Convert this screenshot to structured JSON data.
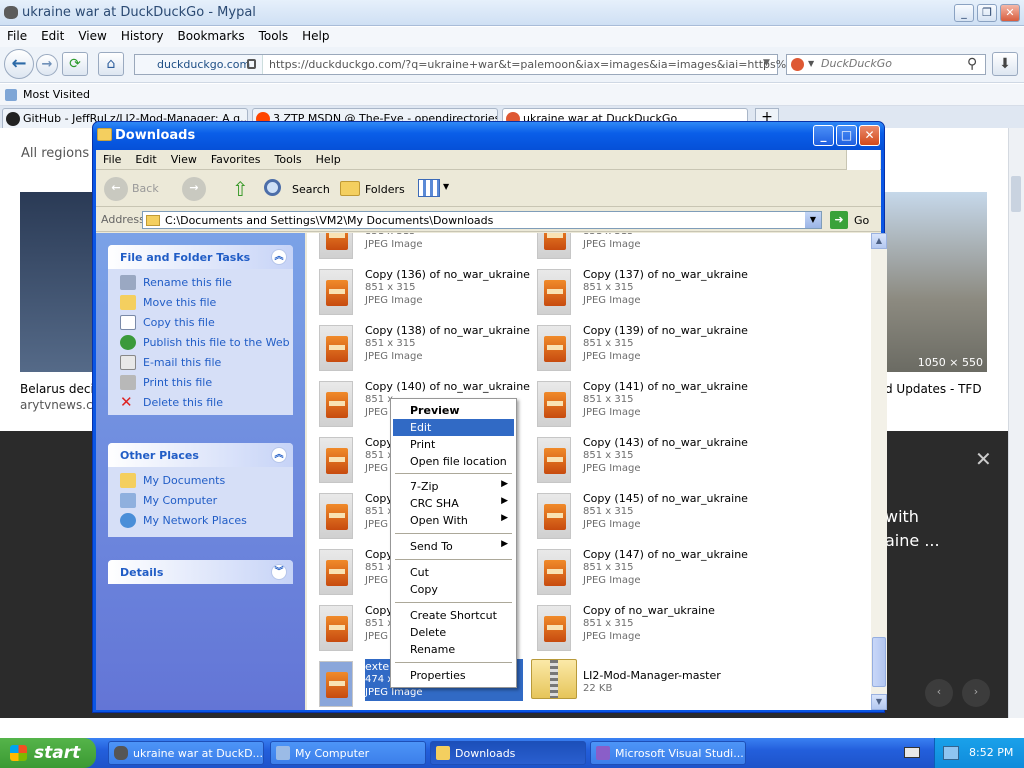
{
  "browser": {
    "title": "ukraine war at DuckDuckGo - Mypal",
    "menu": [
      "File",
      "Edit",
      "View",
      "History",
      "Bookmarks",
      "Tools",
      "Help"
    ],
    "site_label": "duckduckgo.com",
    "url": "https://duckduckgo.com/?q=ukraine+war&t=palemoon&iax=images&ia=images&iai=https%3A%",
    "search_placeholder": "DuckDuckGo",
    "bookmark": "Most Visited",
    "tabs": [
      "GitHub - JeffRuLz/LI2-Mod-Manager: A g...",
      "3 ZTP MSDN @ The-Eye - opendirectories",
      "ukraine war at DuckDuckGo"
    ],
    "page": {
      "all_regions": "All regions",
      "left_caption_1": "Belarus deci",
      "left_caption_2": "arytvnews.co",
      "right_caption": "d Updates - TFD",
      "right_dims": "1050 × 550",
      "overlay_line1": "with",
      "overlay_line2": "aine ..."
    }
  },
  "explorer": {
    "title": "Downloads",
    "menu": [
      "File",
      "Edit",
      "View",
      "Favorites",
      "Tools",
      "Help"
    ],
    "toolbar": {
      "back": "Back",
      "search": "Search",
      "folders": "Folders"
    },
    "address_label": "Address",
    "address": "C:\\Documents and Settings\\VM2\\My Documents\\Downloads",
    "go": "Go",
    "tasks_title": "File and Folder Tasks",
    "tasks": [
      "Rename this file",
      "Move this file",
      "Copy this file",
      "Publish this file to the Web",
      "E-mail this file",
      "Print this file",
      "Delete this file"
    ],
    "places_title": "Other Places",
    "places": [
      "My Documents",
      "My Computer",
      "My Network Places"
    ],
    "details_title": "Details",
    "file_dims": "851 x 315",
    "file_type": "JPEG Image",
    "files_left": [
      "Copy (136) of no_war_ukraine",
      "Copy (138) of no_war_ukraine",
      "Copy (140) of no_war_ukraine",
      "Copy",
      "Copy",
      "Copy",
      "Copy"
    ],
    "files_left_dims_partial": "851 x",
    "files_left_type_partial": "JPEG",
    "files_right": [
      "Copy (137) of no_war_ukraine",
      "Copy (139) of no_war_ukraine",
      "Copy (141) of no_war_ukraine",
      "Copy (143) of no_war_ukraine",
      "Copy (145) of no_war_ukraine",
      "Copy (147) of no_war_ukraine",
      "Copy of no_war_ukraine"
    ],
    "selected_file": {
      "name": "extern",
      "dims": "474 x",
      "type": "JPEG Image"
    },
    "zip_file": {
      "name": "LI2-Mod-Manager-master",
      "size": "22 KB"
    }
  },
  "context_menu": {
    "items": [
      "Preview",
      "Edit",
      "Print",
      "Open file location",
      "7-Zip",
      "CRC SHA",
      "Open With",
      "Send To",
      "Cut",
      "Copy",
      "Create Shortcut",
      "Delete",
      "Rename",
      "Properties"
    ],
    "selected": "Edit"
  },
  "taskbar": {
    "start": "start",
    "items": [
      "ukraine war at DuckD...",
      "My Computer",
      "Downloads",
      "Microsoft Visual Studi..."
    ],
    "time": "8:52 PM"
  }
}
